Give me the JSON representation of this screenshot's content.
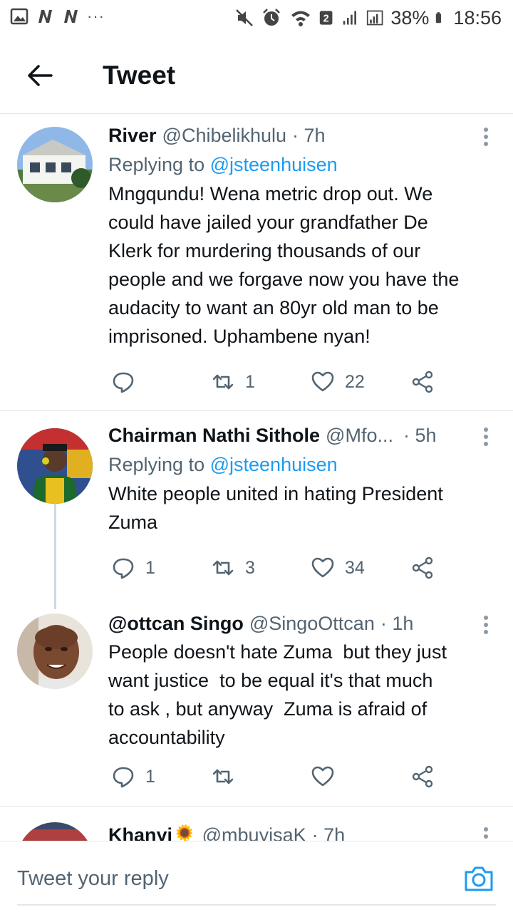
{
  "status_bar": {
    "left_icons": [
      "gallery-icon",
      "n-app-icon",
      "n-app-icon"
    ],
    "dots": "···",
    "battery": "38%",
    "time": "18:56",
    "network_badge": "2"
  },
  "header": {
    "title": "Tweet"
  },
  "colors": {
    "accent": "#1d9bf0",
    "secondary_text": "#536471",
    "primary_text": "#0f1419",
    "divider": "#e6e6e6"
  },
  "tweets": [
    {
      "name": "River",
      "handle": "@Chibelikhulu",
      "time": "· 7h",
      "replying_prefix": "Replying to",
      "replying_to": "@jsteenhuisen",
      "text": "Mngqundu! Wena metric drop out. We\ncould have jailed your grandfather De\nKlerk for murdering thousands of our\npeople and we forgave now you have the\naudacity to want an 80yr old man to be\nimprisoned. Uphambene nyan!",
      "replies": "",
      "retweets": "1",
      "likes": "22"
    },
    {
      "name": "Chairman Nathi Sithole",
      "handle": "@Mfo...",
      "time": "· 5h",
      "replying_prefix": "Replying to",
      "replying_to": "@jsteenhuisen",
      "text": "White people united in hating President\nZuma",
      "replies": "1",
      "retweets": "3",
      "likes": "34"
    },
    {
      "name": "@ottcan Singo",
      "handle": "@SingoOttcan",
      "time": "· 1h",
      "text": "People doesn't hate Zuma  but they just\nwant justice  to be equal it's that much\nto ask , but anyway  Zuma is afraid of\naccountability",
      "replies": "1",
      "retweets": "",
      "likes": ""
    },
    {
      "name": "Khanyi🌻",
      "handle": "@mbuyisaK",
      "time": "· 7h"
    }
  ],
  "reply_bar": {
    "placeholder": "Tweet your reply"
  }
}
